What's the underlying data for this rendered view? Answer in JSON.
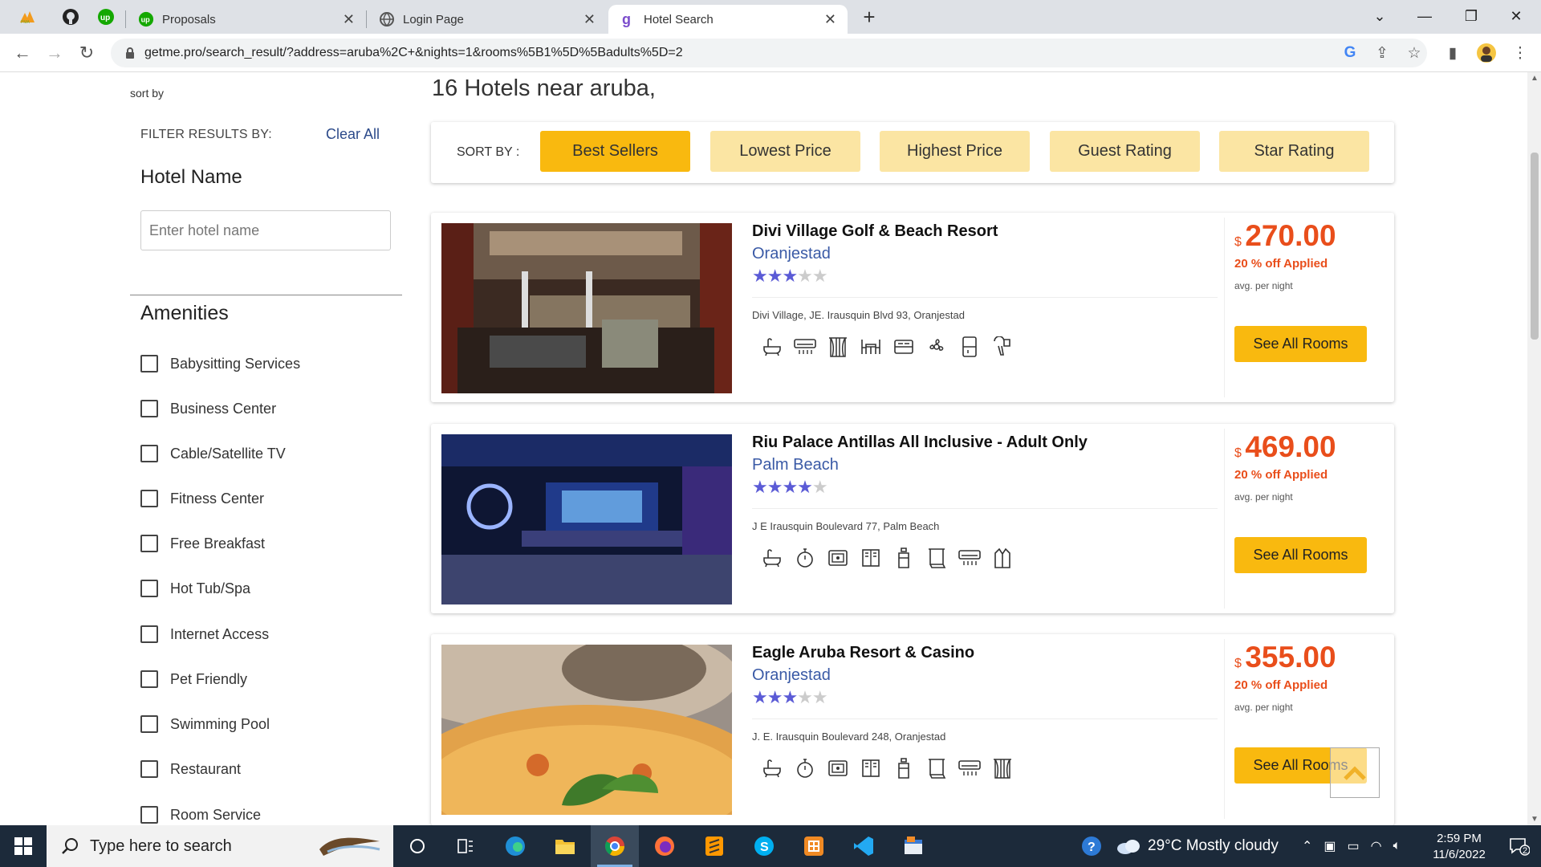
{
  "browser": {
    "tabs": [
      {
        "title": "Proposals"
      },
      {
        "title": "Login Page"
      },
      {
        "title": "Hotel Search"
      }
    ],
    "url": "getme.pro/search_result/?address=aruba%2C+&nights=1&rooms%5B1%5D%5Badults%5D=2"
  },
  "sidebar": {
    "sort_by_text": "sort by",
    "filter_title": "FILTER RESULTS BY:",
    "clear_all": "Clear All",
    "hotel_name_heading": "Hotel Name",
    "hotel_name_placeholder": "Enter hotel name",
    "amenities_heading": "Amenities",
    "amenities": [
      {
        "label": "Babysitting Services",
        "checked": false
      },
      {
        "label": "Business Center",
        "checked": false
      },
      {
        "label": "Cable/Satellite TV",
        "checked": false
      },
      {
        "label": "Fitness Center",
        "checked": false
      },
      {
        "label": "Free Breakfast",
        "checked": false
      },
      {
        "label": "Hot Tub/Spa",
        "checked": false
      },
      {
        "label": "Internet Access",
        "checked": false
      },
      {
        "label": "Pet Friendly",
        "checked": false
      },
      {
        "label": "Swimming Pool",
        "checked": false
      },
      {
        "label": "Restaurant",
        "checked": false
      },
      {
        "label": "Room Service",
        "checked": false
      }
    ]
  },
  "main": {
    "results_heading": "16 Hotels near aruba,",
    "sort": {
      "label": "SORT BY :",
      "options": [
        {
          "label": "Best Sellers",
          "active": true
        },
        {
          "label": "Lowest Price",
          "active": false
        },
        {
          "label": "Highest Price",
          "active": false
        },
        {
          "label": "Guest Rating",
          "active": false
        },
        {
          "label": "Star Rating",
          "active": false
        }
      ]
    },
    "hotels": [
      {
        "name": "Divi Village Golf & Beach Resort",
        "city": "Oranjestad",
        "stars": 3,
        "address": "Divi Village, JE. Irausquin Blvd 93, Oranjestad",
        "currency": "$",
        "price": "270.00",
        "discount": "20 % off Applied",
        "per_night": "avg. per night",
        "button": "See All Rooms",
        "amenity_icons": [
          "bathtub-icon",
          "air-conditioner-icon",
          "curtains-icon",
          "dining-icon",
          "bed-icon",
          "fan-icon",
          "minibar-icon",
          "hairdryer-icon"
        ]
      },
      {
        "name": "Riu Palace Antillas All Inclusive - Adult Only",
        "city": "Palm Beach",
        "stars": 4,
        "address": "J E Irausquin Boulevard 77, Palm Beach",
        "currency": "$",
        "price": "469.00",
        "discount": "20 % off Applied",
        "per_night": "avg. per night",
        "button": "See All Rooms",
        "amenity_icons": [
          "bathtub-icon",
          "clock-icon",
          "safe-icon",
          "wardrobe-icon",
          "toiletries-icon",
          "towel-icon",
          "air-conditioner-icon",
          "bathrobe-icon"
        ]
      },
      {
        "name": "Eagle Aruba Resort & Casino",
        "city": "Oranjestad",
        "stars": 3,
        "address": "J. E. Irausquin Boulevard 248, Oranjestad",
        "currency": "$",
        "price": "355.00",
        "discount": "20 % off Applied",
        "per_night": "avg. per night",
        "button": "See All Rooms",
        "amenity_icons": [
          "bathtub-icon",
          "clock-icon",
          "safe-icon",
          "wardrobe-icon",
          "toiletries-icon",
          "towel-icon",
          "air-conditioner-icon",
          "curtains-icon"
        ]
      }
    ]
  },
  "taskbar": {
    "search_placeholder": "Type here to search",
    "weather": "29°C  Mostly cloudy",
    "time": "2:59 PM",
    "date": "11/6/2022",
    "notification_count": "2"
  },
  "colors": {
    "accent": "#f9b90f",
    "accent_light": "#fbe5a3",
    "price": "#e94e1b",
    "link": "#3a5aa6",
    "star": "#5b5bd6"
  }
}
